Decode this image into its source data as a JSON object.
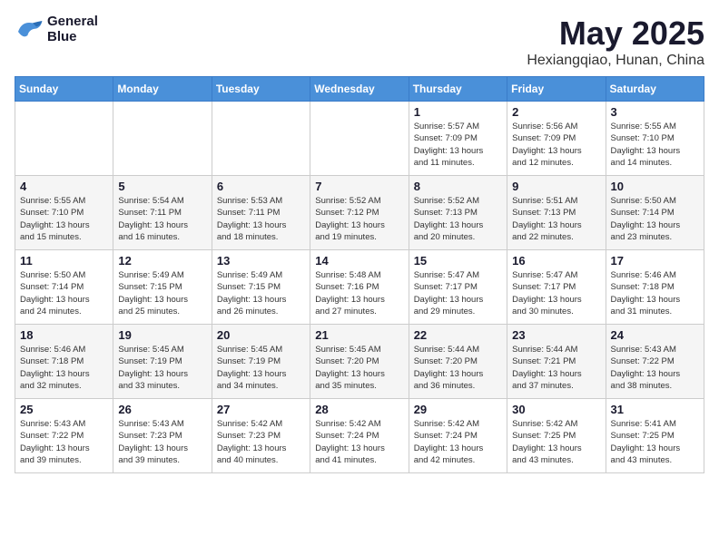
{
  "header": {
    "logo_line1": "General",
    "logo_line2": "Blue",
    "month": "May 2025",
    "location": "Hexiangqiao, Hunan, China"
  },
  "days_of_week": [
    "Sunday",
    "Monday",
    "Tuesday",
    "Wednesday",
    "Thursday",
    "Friday",
    "Saturday"
  ],
  "weeks": [
    [
      {
        "day": "",
        "info": ""
      },
      {
        "day": "",
        "info": ""
      },
      {
        "day": "",
        "info": ""
      },
      {
        "day": "",
        "info": ""
      },
      {
        "day": "1",
        "info": "Sunrise: 5:57 AM\nSunset: 7:09 PM\nDaylight: 13 hours\nand 11 minutes."
      },
      {
        "day": "2",
        "info": "Sunrise: 5:56 AM\nSunset: 7:09 PM\nDaylight: 13 hours\nand 12 minutes."
      },
      {
        "day": "3",
        "info": "Sunrise: 5:55 AM\nSunset: 7:10 PM\nDaylight: 13 hours\nand 14 minutes."
      }
    ],
    [
      {
        "day": "4",
        "info": "Sunrise: 5:55 AM\nSunset: 7:10 PM\nDaylight: 13 hours\nand 15 minutes."
      },
      {
        "day": "5",
        "info": "Sunrise: 5:54 AM\nSunset: 7:11 PM\nDaylight: 13 hours\nand 16 minutes."
      },
      {
        "day": "6",
        "info": "Sunrise: 5:53 AM\nSunset: 7:11 PM\nDaylight: 13 hours\nand 18 minutes."
      },
      {
        "day": "7",
        "info": "Sunrise: 5:52 AM\nSunset: 7:12 PM\nDaylight: 13 hours\nand 19 minutes."
      },
      {
        "day": "8",
        "info": "Sunrise: 5:52 AM\nSunset: 7:13 PM\nDaylight: 13 hours\nand 20 minutes."
      },
      {
        "day": "9",
        "info": "Sunrise: 5:51 AM\nSunset: 7:13 PM\nDaylight: 13 hours\nand 22 minutes."
      },
      {
        "day": "10",
        "info": "Sunrise: 5:50 AM\nSunset: 7:14 PM\nDaylight: 13 hours\nand 23 minutes."
      }
    ],
    [
      {
        "day": "11",
        "info": "Sunrise: 5:50 AM\nSunset: 7:14 PM\nDaylight: 13 hours\nand 24 minutes."
      },
      {
        "day": "12",
        "info": "Sunrise: 5:49 AM\nSunset: 7:15 PM\nDaylight: 13 hours\nand 25 minutes."
      },
      {
        "day": "13",
        "info": "Sunrise: 5:49 AM\nSunset: 7:15 PM\nDaylight: 13 hours\nand 26 minutes."
      },
      {
        "day": "14",
        "info": "Sunrise: 5:48 AM\nSunset: 7:16 PM\nDaylight: 13 hours\nand 27 minutes."
      },
      {
        "day": "15",
        "info": "Sunrise: 5:47 AM\nSunset: 7:17 PM\nDaylight: 13 hours\nand 29 minutes."
      },
      {
        "day": "16",
        "info": "Sunrise: 5:47 AM\nSunset: 7:17 PM\nDaylight: 13 hours\nand 30 minutes."
      },
      {
        "day": "17",
        "info": "Sunrise: 5:46 AM\nSunset: 7:18 PM\nDaylight: 13 hours\nand 31 minutes."
      }
    ],
    [
      {
        "day": "18",
        "info": "Sunrise: 5:46 AM\nSunset: 7:18 PM\nDaylight: 13 hours\nand 32 minutes."
      },
      {
        "day": "19",
        "info": "Sunrise: 5:45 AM\nSunset: 7:19 PM\nDaylight: 13 hours\nand 33 minutes."
      },
      {
        "day": "20",
        "info": "Sunrise: 5:45 AM\nSunset: 7:19 PM\nDaylight: 13 hours\nand 34 minutes."
      },
      {
        "day": "21",
        "info": "Sunrise: 5:45 AM\nSunset: 7:20 PM\nDaylight: 13 hours\nand 35 minutes."
      },
      {
        "day": "22",
        "info": "Sunrise: 5:44 AM\nSunset: 7:20 PM\nDaylight: 13 hours\nand 36 minutes."
      },
      {
        "day": "23",
        "info": "Sunrise: 5:44 AM\nSunset: 7:21 PM\nDaylight: 13 hours\nand 37 minutes."
      },
      {
        "day": "24",
        "info": "Sunrise: 5:43 AM\nSunset: 7:22 PM\nDaylight: 13 hours\nand 38 minutes."
      }
    ],
    [
      {
        "day": "25",
        "info": "Sunrise: 5:43 AM\nSunset: 7:22 PM\nDaylight: 13 hours\nand 39 minutes."
      },
      {
        "day": "26",
        "info": "Sunrise: 5:43 AM\nSunset: 7:23 PM\nDaylight: 13 hours\nand 39 minutes."
      },
      {
        "day": "27",
        "info": "Sunrise: 5:42 AM\nSunset: 7:23 PM\nDaylight: 13 hours\nand 40 minutes."
      },
      {
        "day": "28",
        "info": "Sunrise: 5:42 AM\nSunset: 7:24 PM\nDaylight: 13 hours\nand 41 minutes."
      },
      {
        "day": "29",
        "info": "Sunrise: 5:42 AM\nSunset: 7:24 PM\nDaylight: 13 hours\nand 42 minutes."
      },
      {
        "day": "30",
        "info": "Sunrise: 5:42 AM\nSunset: 7:25 PM\nDaylight: 13 hours\nand 43 minutes."
      },
      {
        "day": "31",
        "info": "Sunrise: 5:41 AM\nSunset: 7:25 PM\nDaylight: 13 hours\nand 43 minutes."
      }
    ]
  ]
}
